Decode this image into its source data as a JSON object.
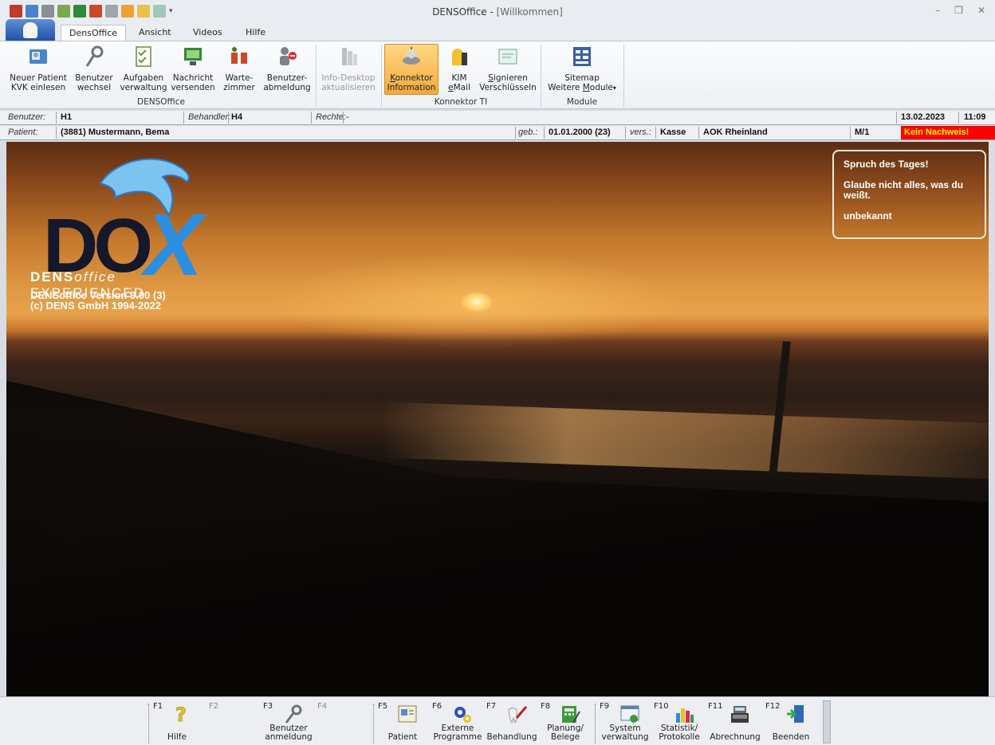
{
  "window": {
    "title": "DENSOffice",
    "subtitle": "[Willkommen]",
    "separator": " - "
  },
  "tabs": [
    "DensOffice",
    "Ansicht",
    "Videos",
    "Hilfe"
  ],
  "ribbon": {
    "groups": [
      {
        "label": "DENSOffice",
        "buttons": [
          {
            "line1": "Neuer Patient",
            "line2": "KVK einlesen",
            "icon": "card-reader-icon"
          },
          {
            "line1": "Benutzer",
            "line2": "wechsel",
            "icon": "key-icon"
          },
          {
            "line1": "Aufgaben",
            "line2": "verwaltung",
            "icon": "checklist-icon"
          },
          {
            "line1": "Nachricht",
            "line2": "versenden",
            "icon": "monitor-message-icon"
          },
          {
            "line1": "Warte-",
            "line2": "zimmer",
            "icon": "waiting-room-icon"
          },
          {
            "line1": "Benutzer-",
            "line2": "abmeldung",
            "icon": "user-logout-icon"
          }
        ]
      },
      {
        "label": "",
        "buttons": [
          {
            "line1": "Info-Desktop",
            "line2": "aktualisieren",
            "icon": "refresh-desktop-icon",
            "disabled": true
          }
        ]
      },
      {
        "label": "Konnektor TI",
        "buttons": [
          {
            "line1": "Konnektor",
            "line2": "Information",
            "icon": "connector-icon",
            "selected": true
          },
          {
            "line1": "KIM",
            "line2": "eMail",
            "icon": "mailbox-icon"
          },
          {
            "line1": "Signieren",
            "line2": "Verschlüsseln",
            "icon": "certificate-icon"
          }
        ]
      },
      {
        "label": "Module",
        "buttons": [
          {
            "line1": "Sitemap",
            "line2": "Weitere Module",
            "icon": "sitemap-icon"
          }
        ]
      }
    ]
  },
  "userbar": {
    "benutzer_label": "Benutzer:",
    "benutzer_value": "H1",
    "behandler_label": "Behandler:",
    "behandler_value": "H4",
    "rechte_label": "Rechte:",
    "rechte_value": "-",
    "date": "13.02.2023",
    "time": "11:09"
  },
  "patientbar": {
    "patient_label": "Patient:",
    "patient_value": "(3881) Mustermann, Bema",
    "geb_label": "geb.:",
    "geb_value": "01.01.2000 (23)",
    "vers_label": "vers.:",
    "vers_value": "Kasse",
    "kasse": "AOK Rheinland",
    "code": "M/1",
    "nachweis": "Kein Nachweis!"
  },
  "splash": {
    "logo_dox": "DO",
    "logo_x": "X",
    "tag_dens": "DENS",
    "tag_office": "office",
    "tag_rest": " EXPERIENCED",
    "version_line1": "DENSoffice Version 9.00 (3)",
    "version_line2": "(c) DENS GmbH 1994-2022"
  },
  "quote": {
    "title": "Spruch des Tages!",
    "text": "Glaube nicht alles, was du weißt.",
    "author": "unbekannt"
  },
  "fkeys": [
    {
      "key": "F1",
      "label1": "",
      "label2": "Hilfe",
      "icon": "question-icon"
    },
    {
      "key": "F2",
      "label1": "",
      "label2": "",
      "icon": "",
      "dim": true
    },
    {
      "key": "F3",
      "label1": "Benutzer",
      "label2": "anmeldung",
      "icon": "key-icon"
    },
    {
      "key": "F4",
      "label1": "",
      "label2": "",
      "icon": "",
      "dim": true
    },
    {
      "key": "F5",
      "label1": "",
      "label2": "Patient",
      "icon": "patient-card-icon"
    },
    {
      "key": "F6",
      "label1": "Externe",
      "label2": "Programme",
      "icon": "gears-icon"
    },
    {
      "key": "F7",
      "label1": "",
      "label2": "Behandlung",
      "icon": "tooth-tool-icon"
    },
    {
      "key": "F8",
      "label1": "Planung/",
      "label2": "Belege",
      "icon": "calculator-icon"
    },
    {
      "key": "F9",
      "label1": "System",
      "label2": "verwaltung",
      "icon": "system-window-icon"
    },
    {
      "key": "F10",
      "label1": "Statistik/",
      "label2": "Protokolle",
      "icon": "bar-chart-icon"
    },
    {
      "key": "F11",
      "label1": "",
      "label2": "Abrechnung",
      "icon": "cash-register-icon"
    },
    {
      "key": "F12",
      "label1": "",
      "label2": "Beenden",
      "icon": "exit-door-icon"
    }
  ],
  "colors": {
    "accent_blue": "#1e4fa5",
    "selected_orange": "#f4a93c",
    "alert_red": "#ff0000",
    "alert_yellow": "#ffff00"
  }
}
